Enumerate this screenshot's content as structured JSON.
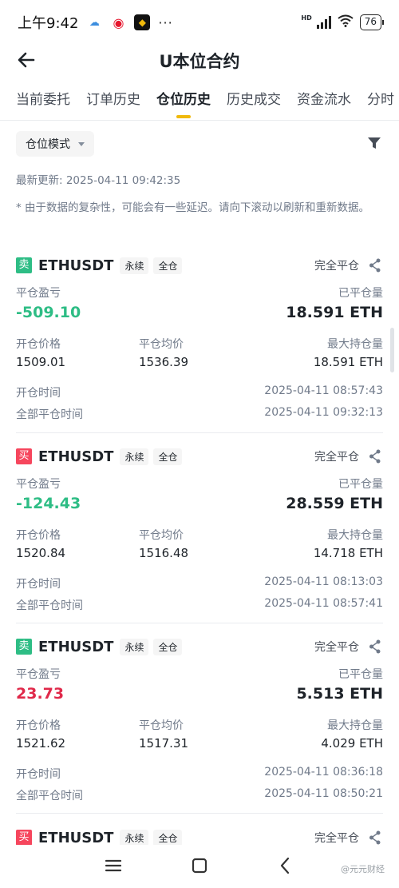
{
  "status_bar": {
    "time": "上午9:42",
    "more": "···",
    "network": "HD",
    "battery": "76"
  },
  "header": {
    "title": "U本位合约"
  },
  "tabs": [
    {
      "label": "当前委托"
    },
    {
      "label": "订单历史"
    },
    {
      "label": "仓位历史"
    },
    {
      "label": "历史成交"
    },
    {
      "label": "资金流水"
    },
    {
      "label": "分时"
    }
  ],
  "filter": {
    "mode_label": "仓位模式"
  },
  "last_update": "最新更新: 2025-04-11 09:42:35",
  "notice": "* 由于数据的复杂性，可能会有一些延迟。请向下滚动以刷新和重新数据。",
  "labels": {
    "pnl": "平仓盈亏",
    "closed_qty": "已平仓量",
    "open_price": "开仓价格",
    "close_avg": "平仓均价",
    "max_position": "最大持仓量",
    "open_time": "开仓时间",
    "full_close_time": "全部平仓时间"
  },
  "positions": [
    {
      "side": "卖",
      "symbol": "ETHUSDT",
      "type_tag": "永续",
      "margin_tag": "全仓",
      "status": "完全平仓",
      "pnl": "-509.10",
      "closed_qty": "18.591 ETH",
      "open_price": "1509.01",
      "close_avg": "1536.39",
      "max_position": "18.591 ETH",
      "open_time": "2025-04-11 08:57:43",
      "full_close_time": "2025-04-11 09:32:13"
    },
    {
      "side": "买",
      "symbol": "ETHUSDT",
      "type_tag": "永续",
      "margin_tag": "全仓",
      "status": "完全平仓",
      "pnl": "-124.43",
      "closed_qty": "28.559 ETH",
      "open_price": "1520.84",
      "close_avg": "1516.48",
      "max_position": "14.718 ETH",
      "open_time": "2025-04-11 08:13:03",
      "full_close_time": "2025-04-11 08:57:41"
    },
    {
      "side": "卖",
      "symbol": "ETHUSDT",
      "type_tag": "永续",
      "margin_tag": "全仓",
      "status": "完全平仓",
      "pnl": "23.73",
      "closed_qty": "5.513 ETH",
      "open_price": "1521.62",
      "close_avg": "1517.31",
      "max_position": "4.029 ETH",
      "open_time": "2025-04-11 08:36:18",
      "full_close_time": "2025-04-11 08:50:21"
    },
    {
      "side": "买",
      "symbol": "ETHUSDT",
      "type_tag": "永续",
      "margin_tag": "全仓",
      "status": "完全平仓"
    }
  ],
  "watermark": "@元元财经",
  "colors": {
    "accent": "#f0b90b",
    "sell_badge": "#2ebd85",
    "buy_badge": "#f6465d",
    "loss_text": "#2ebd85",
    "profit_text": "#e0294a"
  }
}
